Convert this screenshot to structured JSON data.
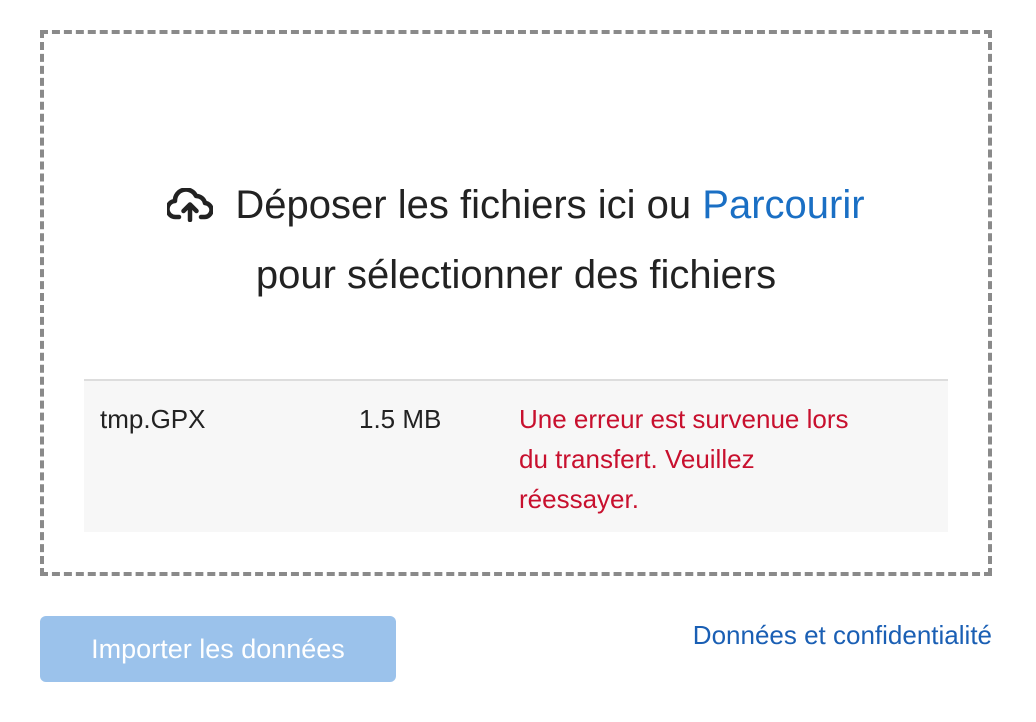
{
  "dropzone": {
    "icon": "cloud-upload-icon",
    "line1_text": "Déposer les fichiers ici ou",
    "browse_link": "Parcourir",
    "line2_text": "pour sélectionner des fichiers"
  },
  "files": [
    {
      "name": "tmp.GPX",
      "size": "1.5 MB",
      "error": "Une erreur est survenue lors du transfert. Veuillez réessayer."
    }
  ],
  "footer": {
    "import_button": "Importer les données",
    "privacy_link": "Données et confidentialité"
  },
  "colors": {
    "link": "#1a6fc4",
    "error": "#c8102e",
    "button_disabled": "#9bc2eb",
    "border": "#8a8a8a"
  }
}
